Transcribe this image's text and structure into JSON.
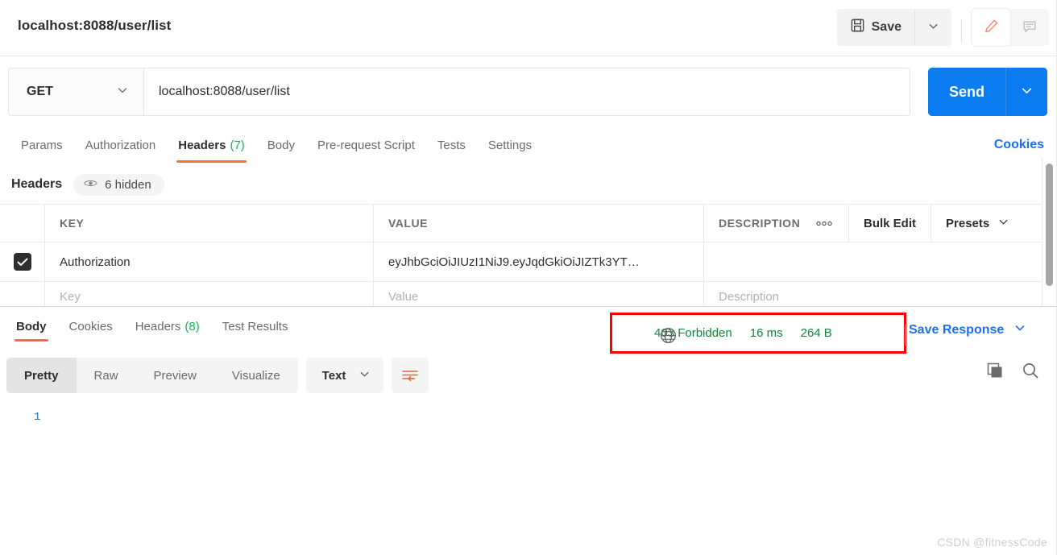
{
  "window": {
    "request_title": "localhost:8088/user/list",
    "watermark": "CSDN @fitnessCode"
  },
  "toolbar": {
    "save_label": "Save",
    "save_icon": "floppy-disk-icon",
    "save_caret_icon": "chevron-down-icon",
    "edit_icon": "pencil-icon",
    "comment_icon": "comment-icon",
    "accent_color": "#ff6c37"
  },
  "url_bar": {
    "method": "GET",
    "method_caret_icon": "chevron-down-icon",
    "url": "localhost:8088/user/list",
    "send_label": "Send",
    "send_caret_icon": "chevron-down-icon",
    "send_color": "#0b7cf0"
  },
  "request_tabs": {
    "items": [
      {
        "label": "Params",
        "count": "",
        "active": false
      },
      {
        "label": "Authorization",
        "count": "",
        "active": false
      },
      {
        "label": "Headers",
        "count": "(7)",
        "active": true
      },
      {
        "label": "Body",
        "count": "",
        "active": false
      },
      {
        "label": "Pre-request Script",
        "count": "",
        "active": false
      },
      {
        "label": "Tests",
        "count": "",
        "active": false
      },
      {
        "label": "Settings",
        "count": "",
        "active": false
      }
    ],
    "cookies_label": "Cookies"
  },
  "headers_section": {
    "title": "Headers",
    "hidden_pill": "6 hidden",
    "eye_icon": "eye-icon",
    "columns": {
      "key": "KEY",
      "value": "VALUE",
      "description": "DESCRIPTION"
    },
    "tools": {
      "more_icon": "more-options-icon",
      "bulk_edit": "Bulk Edit",
      "presets": "Presets",
      "presets_caret_icon": "chevron-down-icon"
    },
    "rows": [
      {
        "checked": true,
        "key": "Authorization",
        "value": "eyJhbGciOiJIUzI1NiJ9.eyJqdGkiOiJIZTk3YT…",
        "description": ""
      }
    ],
    "placeholder_row": {
      "key": "Key",
      "value": "Value",
      "description": "Description"
    }
  },
  "response": {
    "tabs": [
      {
        "label": "Body",
        "count": "",
        "active": true
      },
      {
        "label": "Cookies",
        "count": "",
        "active": false
      },
      {
        "label": "Headers",
        "count": "(8)",
        "active": false
      },
      {
        "label": "Test Results",
        "count": "",
        "active": false
      }
    ],
    "status": {
      "globe_icon": "globe-icon",
      "code": "403 Forbidden",
      "time": "16 ms",
      "size": "264 B",
      "status_color": "#0f8a3c",
      "highlight_color": "#ff0000"
    },
    "save_response_label": "Save Response",
    "save_response_caret_icon": "chevron-down-icon",
    "view_modes": [
      {
        "label": "Pretty",
        "active": true
      },
      {
        "label": "Raw",
        "active": false
      },
      {
        "label": "Preview",
        "active": false
      },
      {
        "label": "Visualize",
        "active": false
      }
    ],
    "format_select": "Text",
    "format_caret_icon": "chevron-down-icon",
    "wrap_icon": "word-wrap-icon",
    "copy_icon": "copy-icon",
    "search_icon": "search-icon",
    "body_line_number": "1",
    "body_text": ""
  }
}
